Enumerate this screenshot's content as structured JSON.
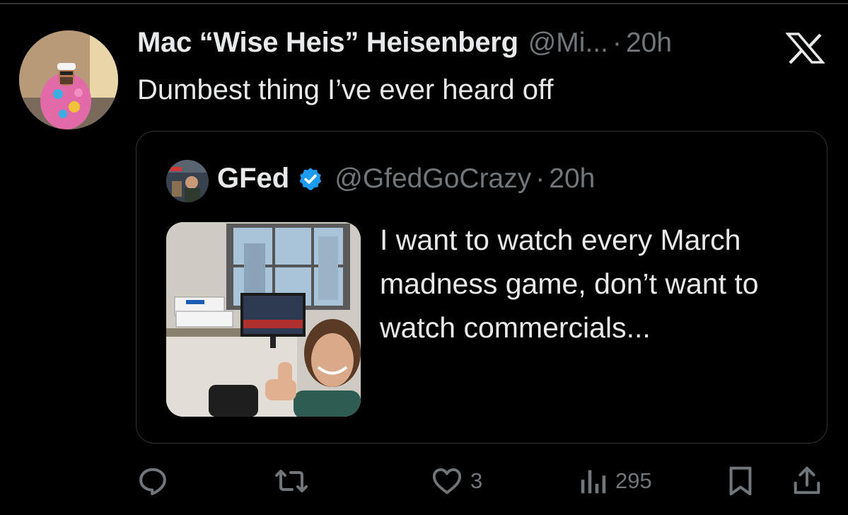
{
  "tweet": {
    "author_name": "Mac “Wise Heis” Heisenberg",
    "author_handle": "@Mi...",
    "separator": "·",
    "time": "20h",
    "text": "Dumbest thing I’ve ever heard off"
  },
  "quoted_tweet": {
    "author_name": "GFed",
    "author_handle": "@GfedGoCrazy",
    "separator": "·",
    "time": "20h",
    "text": "I want to watch every March madness game, don’t want to watch commercials..."
  },
  "actions": {
    "reply_count": "",
    "retweet_count": "",
    "like_count": "3",
    "view_count": "295"
  },
  "icons": {
    "brand": "x-logo-icon",
    "verified": "verified-badge-icon",
    "reply": "reply-icon",
    "retweet": "retweet-icon",
    "like": "heart-icon",
    "views": "views-chart-icon",
    "bookmark": "bookmark-icon",
    "share": "share-icon"
  },
  "colors": {
    "background": "#000000",
    "text_primary": "#e7e9ea",
    "text_secondary": "#71767b",
    "border": "#2f3336",
    "verified_blue": "#1d9bf0"
  }
}
